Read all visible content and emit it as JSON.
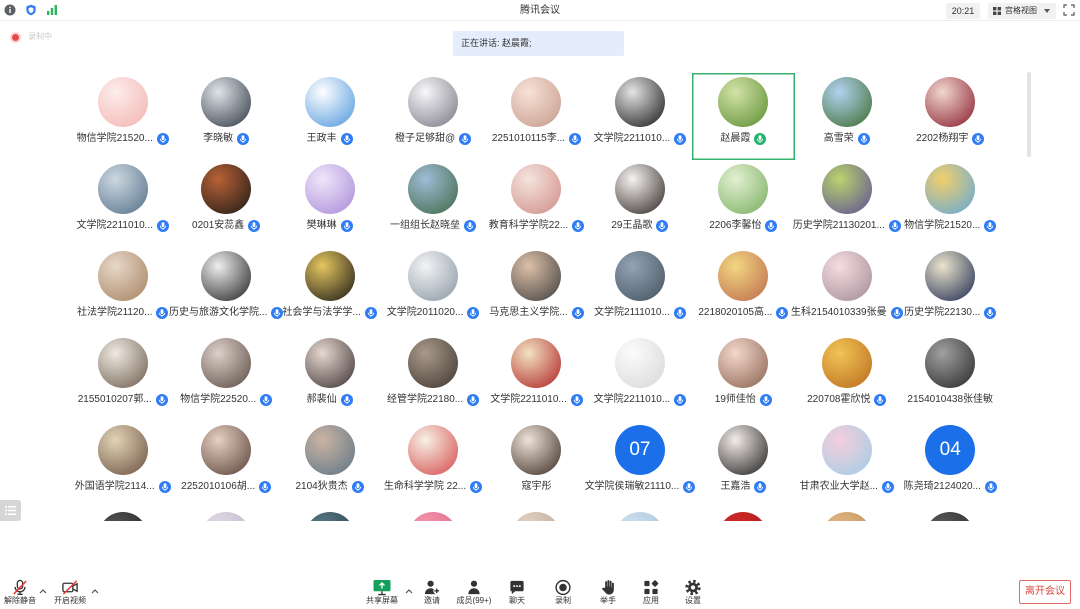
{
  "app": {
    "title": "腾讯会议"
  },
  "header": {
    "time": "20:21",
    "view_mode": "宫格视图"
  },
  "status": {
    "recording_label": "录制中",
    "speaking_label": "正在讲话: 赵晨霞;"
  },
  "grid": {
    "participants": [
      {
        "name": "物信学院21520...",
        "mic_icon": "mic-on-icon",
        "avatar": [
          "#fdeceb",
          "#f1b3ae"
        ]
      },
      {
        "name": "李晓敏",
        "mic_icon": "mic-on-icon",
        "avatar": [
          "#dfe4e8",
          "#2d3541"
        ]
      },
      {
        "name": "王政丰",
        "mic_icon": "mic-on-icon",
        "avatar": [
          "#ffffff",
          "#4c95dc"
        ]
      },
      {
        "name": "橙子足够甜@",
        "mic_icon": "mic-on-icon",
        "avatar": [
          "#f8f7f9",
          "#777582"
        ]
      },
      {
        "name": "2251010115李...",
        "mic_icon": "mic-on-icon",
        "avatar": [
          "#f7e2d6",
          "#c4998a"
        ]
      },
      {
        "name": "文学院2211010...",
        "mic_icon": "mic-on-icon",
        "avatar": [
          "#e4e4e4",
          "#141414"
        ]
      },
      {
        "name": "赵晨霞",
        "mic_icon": "mic-speaking-icon",
        "avatar": [
          "#d3e3a8",
          "#5a8c30"
        ]
      },
      {
        "name": "高雪荣",
        "mic_icon": "mic-on-icon",
        "avatar": [
          "#b2d3f1",
          "#3b6a2a"
        ]
      },
      {
        "name": "2202杨翔宇",
        "mic_icon": "mic-on-icon",
        "avatar": [
          "#f1d6cf",
          "#86192a"
        ]
      },
      {
        "name": "文学院2211010...",
        "mic_icon": "mic-on-icon",
        "avatar": [
          "#cdd8e1",
          "#536f88"
        ]
      },
      {
        "name": "0201安蕊鑫",
        "mic_icon": "mic-on-icon",
        "avatar": [
          "#b86236",
          "#1c1917"
        ]
      },
      {
        "name": "樊琳琳",
        "mic_icon": "mic-on-icon",
        "avatar": [
          "#efe6fa",
          "#a889d8"
        ]
      },
      {
        "name": "一组组长赵晓垒",
        "mic_icon": "mic-on-icon",
        "avatar": [
          "#9fbcd6",
          "#3d6845"
        ]
      },
      {
        "name": "教育科学学院22...",
        "mic_icon": "mic-on-icon",
        "avatar": [
          "#f5e3de",
          "#cf8d85"
        ]
      },
      {
        "name": "29王晶歌",
        "mic_icon": "mic-on-icon",
        "avatar": [
          "#f6f3f0",
          "#2b2321"
        ]
      },
      {
        "name": "2206李馨怡",
        "mic_icon": "mic-on-icon",
        "avatar": [
          "#e2f0d2",
          "#78ad5e"
        ]
      },
      {
        "name": "历史学院21130201...",
        "mic_icon": "mic-on-icon",
        "avatar": [
          "#b9d46c",
          "#5d4d96"
        ]
      },
      {
        "name": "物信学院21520...",
        "mic_icon": "mic-on-icon",
        "avatar": [
          "#f2cf6b",
          "#5fa7dc"
        ]
      },
      {
        "name": "社法学院21120...",
        "mic_icon": "mic-on-icon",
        "avatar": [
          "#e6d8c8",
          "#a5805f"
        ]
      },
      {
        "name": "历史与旅游文化学院...",
        "mic_icon": "mic-on-icon",
        "avatar": [
          "#efefef",
          "#1e1e1e"
        ]
      },
      {
        "name": "社会学与法学学...",
        "mic_icon": "mic-on-icon",
        "avatar": [
          "#e6c65f",
          "#161616"
        ]
      },
      {
        "name": "文学院2011020...",
        "mic_icon": "mic-on-icon",
        "avatar": [
          "#f3f3f3",
          "#8795a3"
        ]
      },
      {
        "name": "马克思主义学院...",
        "mic_icon": "mic-on-icon",
        "avatar": [
          "#ddc0a8",
          "#3d3d3d"
        ]
      },
      {
        "name": "文学院2111010...",
        "mic_icon": "mic-on-icon",
        "avatar": [
          "#93a3b2",
          "#44525f"
        ]
      },
      {
        "name": "2218020105高...",
        "mic_icon": "mic-on-icon",
        "avatar": [
          "#f3d682",
          "#bb6a4b"
        ]
      },
      {
        "name": "生科2154010339张曼",
        "mic_icon": "mic-on-icon",
        "avatar": [
          "#f6dde3",
          "#a18a92"
        ]
      },
      {
        "name": "历史学院22130...",
        "mic_icon": "mic-on-icon",
        "avatar": [
          "#ebe3cc",
          "#19284d"
        ]
      },
      {
        "name": "2155010207郭...",
        "mic_icon": "mic-on-icon",
        "avatar": [
          "#efe9e2",
          "#6b5b4b"
        ]
      },
      {
        "name": "物信学院22520...",
        "mic_icon": "mic-on-icon",
        "avatar": [
          "#ddd0c8",
          "#584a41"
        ]
      },
      {
        "name": "郝裴仙",
        "mic_icon": "mic-on-icon",
        "avatar": [
          "#e6d7cf",
          "#3a3030"
        ]
      },
      {
        "name": "经管学院22180...",
        "mic_icon": "mic-on-icon",
        "avatar": [
          "#a9998a",
          "#3e3630"
        ]
      },
      {
        "name": "文学院2211010...",
        "mic_icon": "mic-on-icon",
        "avatar": [
          "#f1e2c2",
          "#ad1f1f"
        ]
      },
      {
        "name": "文学院2211010...",
        "mic_icon": "mic-on-icon",
        "avatar": [
          "#fcfcfc",
          "#d6d6d6"
        ]
      },
      {
        "name": "19师佳怡",
        "mic_icon": "mic-on-icon",
        "avatar": [
          "#f4d8ca",
          "#87604f"
        ]
      },
      {
        "name": "220708霍欣悦",
        "mic_icon": "mic-on-icon",
        "avatar": [
          "#f2c455",
          "#b86a1e"
        ]
      },
      {
        "name": "2154010438张佳敏",
        "avatar": [
          "#a0a0a0",
          "#272727"
        ]
      },
      {
        "name": "外国语学院2114...",
        "mic_icon": "mic-on-icon",
        "avatar": [
          "#e2d4b6",
          "#6a5040"
        ]
      },
      {
        "name": "2252010106胡...",
        "mic_icon": "mic-on-icon",
        "avatar": [
          "#e6d0c1",
          "#573e36"
        ]
      },
      {
        "name": "2104狄贵杰",
        "mic_icon": "mic-on-icon",
        "avatar": [
          "#cbb4a4",
          "#5b7484"
        ]
      },
      {
        "name": "生命科学学院 22...",
        "mic_icon": "mic-on-icon",
        "avatar": [
          "#f7f1e6",
          "#d44848"
        ]
      },
      {
        "name": "寇宇彤",
        "avatar": [
          "#ede3d9",
          "#3a2a21"
        ]
      },
      {
        "name": "文学院侯瑞敏21110...",
        "mic_icon": "mic-on-icon",
        "initials": "07",
        "avatar": [
          "#1b6fe8",
          "#1b6fe8"
        ]
      },
      {
        "name": "王嘉浩",
        "mic_icon": "mic-on-icon",
        "avatar": [
          "#f3ece8",
          "#1b1b1b"
        ]
      },
      {
        "name": "甘肃农业大学赵...",
        "mic_icon": "mic-on-icon",
        "avatar": [
          "#f4cedc",
          "#9fcde6"
        ]
      },
      {
        "name": "陈尧琦2124020...",
        "mic_icon": "mic-on-icon",
        "initials": "04",
        "avatar": [
          "#1b6fe8",
          "#1b6fe8"
        ]
      }
    ],
    "partial_row": [
      {
        "avatar": [
          "#555555",
          "#1f1f1f"
        ]
      },
      {
        "avatar": [
          "#e2dbe8",
          "#b8aec4"
        ]
      },
      {
        "avatar": [
          "#5a7a88",
          "#263a44"
        ]
      },
      {
        "avatar": [
          "#f29ab0",
          "#e0587a"
        ]
      },
      {
        "avatar": [
          "#e4d6c8",
          "#b59d88"
        ]
      },
      {
        "avatar": [
          "#cfe1ef",
          "#9ebfd9"
        ]
      },
      {
        "avatar": [
          "#d42a2a",
          "#a31616"
        ]
      },
      {
        "avatar": [
          "#e2b986",
          "#b9864e"
        ]
      },
      {
        "avatar": [
          "#5a5a5a",
          "#262626"
        ]
      }
    ]
  },
  "toolbar": {
    "unmute": "解除静音",
    "video": "开启视频",
    "share": "共享屏幕",
    "invite": "邀请",
    "members": "成员(99+)",
    "chat": "聊天",
    "record": "录制",
    "raise_hand": "举手",
    "apps": "应用",
    "settings": "设置",
    "leave": "离开会议"
  }
}
